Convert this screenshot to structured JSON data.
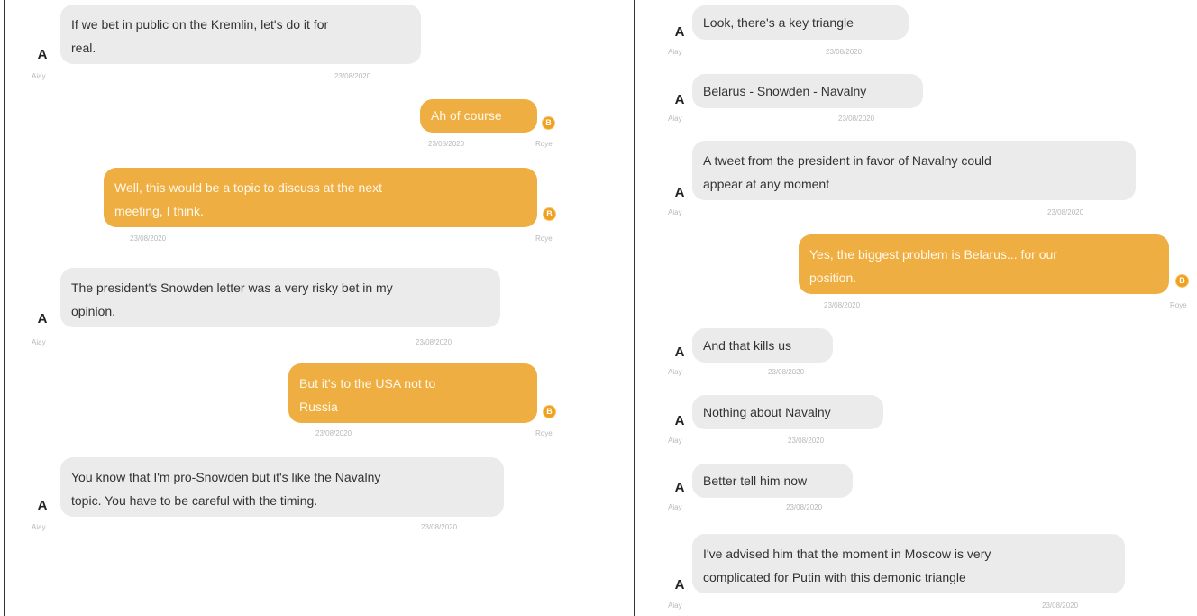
{
  "left_conversation": [
    {
      "sender": "A",
      "name": "Aiay",
      "text": "If we bet in public on the Kremlin, let's do it for\nreal.",
      "time": "23/08/2020"
    },
    {
      "sender": "B",
      "name": "Roye",
      "text": "Ah of course",
      "time": "23/08/2020"
    },
    {
      "sender": "B",
      "name": "Roye",
      "text": "Well, this would be a topic to discuss at the next\nmeeting, I think.",
      "time": "23/08/2020"
    },
    {
      "sender": "A",
      "name": "Aiay",
      "text": "The president's Snowden letter was a very risky bet in my\nopinion.",
      "time": "23/08/2020"
    },
    {
      "sender": "B",
      "name": "Roye",
      "text": "But it's to the USA not to\nRussia",
      "time": "23/08/2020"
    },
    {
      "sender": "A",
      "name": "Aiay",
      "text": "You know that I'm pro-Snowden but it's like the Navalny\ntopic. You have to be careful with the timing.",
      "time": "23/08/2020"
    }
  ],
  "right_conversation": [
    {
      "sender": "A",
      "name": "Aiay",
      "text": "Look, there's a key triangle",
      "time": "23/08/2020"
    },
    {
      "sender": "A",
      "name": "Aiay",
      "text": "Belarus - Snowden - Navalny",
      "time": "23/08/2020"
    },
    {
      "sender": "A",
      "name": "Aiay",
      "text": "A tweet from the president in favor of Navalny could\nappear at any moment",
      "time": "23/08/2020"
    },
    {
      "sender": "B",
      "name": "Roye",
      "text": "Yes, the biggest problem is Belarus... for our\nposition.",
      "time": "23/08/2020"
    },
    {
      "sender": "A",
      "name": "Aiay",
      "text": "And that kills us",
      "time": "23/08/2020"
    },
    {
      "sender": "A",
      "name": "Aiay",
      "text": "Nothing about Navalny",
      "time": "23/08/2020"
    },
    {
      "sender": "A",
      "name": "Aiay",
      "text": "Better tell him now",
      "time": "23/08/2020"
    },
    {
      "sender": "A",
      "name": "Aiay",
      "text": "I've advised him that the moment in Moscow is very\ncomplicated for Putin with this demonic triangle",
      "time": "23/08/2020"
    }
  ],
  "colors": {
    "incoming_bubble": "#ebebeb",
    "outgoing_bubble": "#efae42",
    "avatar_b": "#f0a01e"
  },
  "icons": {
    "avatar_a": "letter-a-avatar",
    "avatar_b": "letter-b-circle-avatar"
  }
}
